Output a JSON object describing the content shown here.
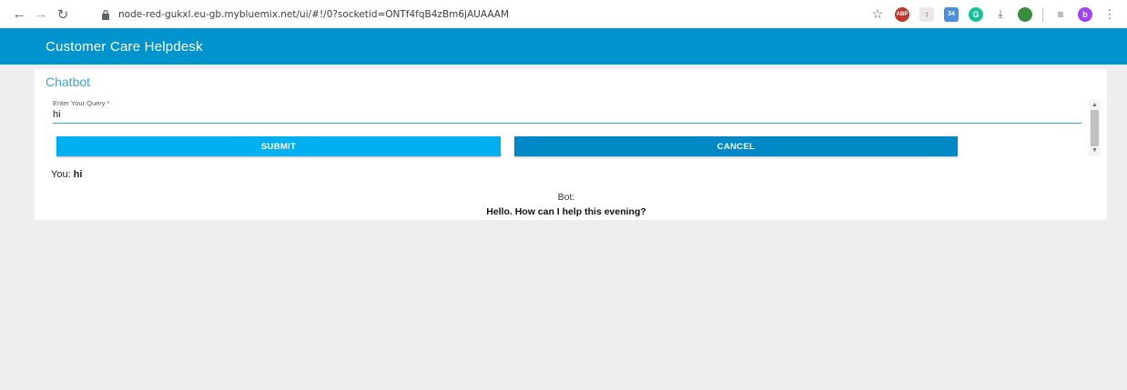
{
  "browser": {
    "url": "node-red-gukxl.eu-gb.mybluemix.net/ui/#!/0?socketid=ONTf4fqB4zBm6jAUAAAM",
    "extensions": [
      "star-icon",
      "abp-icon",
      "pdf-icon",
      "calendar-icon",
      "grammarly-icon",
      "download-icon",
      "globe-icon",
      "playlist-icon",
      "profile-avatar",
      "menu-icon"
    ],
    "abp_label": "ABP",
    "calendar_badge": "34",
    "avatar_letter": "b"
  },
  "header": {
    "title": "Customer Care Helpdesk",
    "bg_color": "#0094ce"
  },
  "card": {
    "title": "Chatbot",
    "query_label": "Enter Your Query",
    "query_required_mark": "*",
    "query_value": "hi",
    "submit_label": "SUBMIT",
    "cancel_label": "CANCEL",
    "you_prefix": "You:",
    "you_message": "hi",
    "bot_label": "Bot:",
    "bot_reply": "Hello. How can I help this evening?"
  },
  "colors": {
    "accent": "#3aa6d5",
    "submit_bg": "#00b0f0",
    "cancel_bg": "#0089c6"
  }
}
